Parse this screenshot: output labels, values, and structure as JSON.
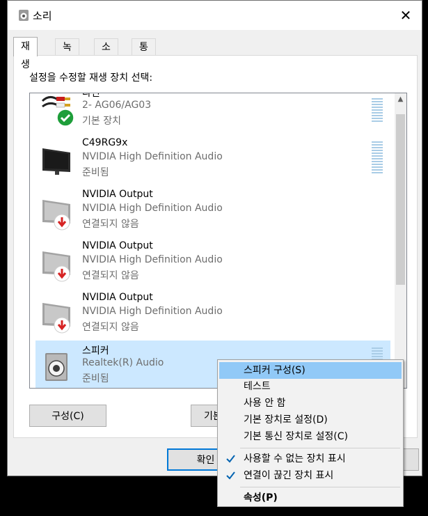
{
  "window": {
    "title": "소리",
    "close": "✕"
  },
  "tabs": [
    "재생",
    "녹음",
    "소리",
    "통신"
  ],
  "prompt": "설정을 수정할 재생 장치 선택:",
  "devices": [
    {
      "name": "라인",
      "description": "2- AG06/AG03",
      "status": "기본 장치",
      "icon": "rca-cable-icon",
      "badge": "default-check"
    },
    {
      "name": "C49RG9x",
      "description": "NVIDIA High Definition Audio",
      "status": "준비됨",
      "icon": "monitor-icon",
      "badge": ""
    },
    {
      "name": "NVIDIA Output",
      "description": "NVIDIA High Definition Audio",
      "status": "연결되지 않음",
      "icon": "monitor-icon",
      "badge": "disconnected"
    },
    {
      "name": "NVIDIA Output",
      "description": "NVIDIA High Definition Audio",
      "status": "연결되지 않음",
      "icon": "monitor-icon",
      "badge": "disconnected"
    },
    {
      "name": "NVIDIA Output",
      "description": "NVIDIA High Definition Audio",
      "status": "연결되지 않음",
      "icon": "monitor-icon",
      "badge": "disconnected"
    },
    {
      "name": "스피커",
      "description": "Realtek(R) Audio",
      "status": "준비됨",
      "icon": "speaker-icon",
      "badge": ""
    }
  ],
  "buttons": {
    "configure": "구성(C)",
    "set_default": "기본",
    "ok": "확인"
  },
  "context_menu": {
    "configure_speakers": "스피커 구성(S)",
    "test": "테스트",
    "disable": "사용 안 함",
    "set_default_device": "기본 장치로 설정(D)",
    "set_default_comm": "기본 통신 장치로 설정(C)",
    "show_disabled": "사용할 수 없는 장치 표시",
    "show_disconnected": "연결이 끊긴 장치 표시",
    "properties": "속성(P)"
  },
  "colors": {
    "selection": "#cce8ff",
    "menu_hover": "#91c9f7",
    "accent": "#0078d7",
    "check_green": "#1e9e3a",
    "warning_red": "#d62323"
  }
}
